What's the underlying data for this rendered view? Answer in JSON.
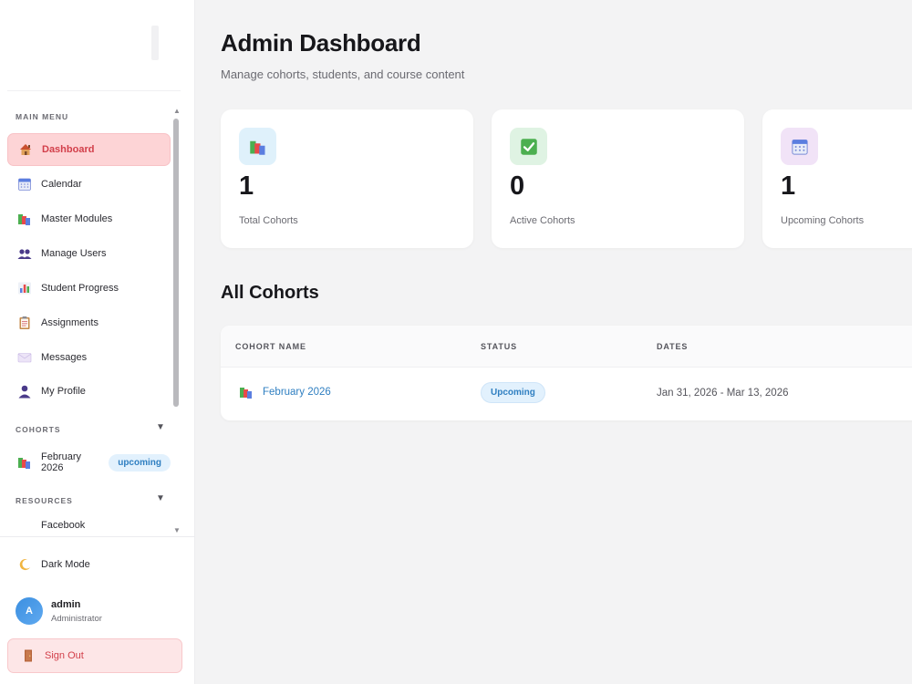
{
  "sidebar": {
    "main_menu_label": "MAIN MENU",
    "items": [
      {
        "label": "Dashboard",
        "icon": "house-icon",
        "active": true
      },
      {
        "label": "Calendar",
        "icon": "calendar-icon"
      },
      {
        "label": "Master Modules",
        "icon": "books-icon"
      },
      {
        "label": "Manage Users",
        "icon": "users-icon"
      },
      {
        "label": "Student Progress",
        "icon": "bar-chart-icon"
      },
      {
        "label": "Assignments",
        "icon": "clipboard-icon"
      },
      {
        "label": "Messages",
        "icon": "envelope-icon"
      },
      {
        "label": "My Profile",
        "icon": "person-icon"
      }
    ],
    "cohorts_label": "COHORTS",
    "cohort": {
      "label": "February 2026",
      "badge": "upcoming"
    },
    "resources_label": "RESOURCES",
    "resources": [
      {
        "label": "Facebook",
        "icon": "facebook-icon"
      }
    ],
    "dark_mode_label": "Dark Mode",
    "user": {
      "initial": "A",
      "name": "admin",
      "role": "Administrator"
    },
    "sign_out_label": "Sign Out"
  },
  "header": {
    "title": "Admin Dashboard",
    "subtitle": "Manage cohorts, students, and course content"
  },
  "stats": [
    {
      "value": "1",
      "label": "Total Cohorts",
      "icon": "books-icon",
      "bg": "#dff1fb"
    },
    {
      "value": "0",
      "label": "Active Cohorts",
      "icon": "check-icon",
      "bg": "#dff3e3"
    },
    {
      "value": "1",
      "label": "Upcoming Cohorts",
      "icon": "calendar-icon",
      "bg": "#f1e3f7"
    }
  ],
  "cohorts_table": {
    "title": "All Cohorts",
    "headers": [
      "COHORT NAME",
      "STATUS",
      "DATES"
    ],
    "rows": [
      {
        "name": "February 2026",
        "status": "Upcoming",
        "dates": "Jan 31, 2026 - Mar 13, 2026"
      }
    ]
  },
  "colors": {
    "accent_red": "#d23f4a",
    "accent_blue": "#2f7fc1",
    "active_bg": "#fdd4d6"
  }
}
